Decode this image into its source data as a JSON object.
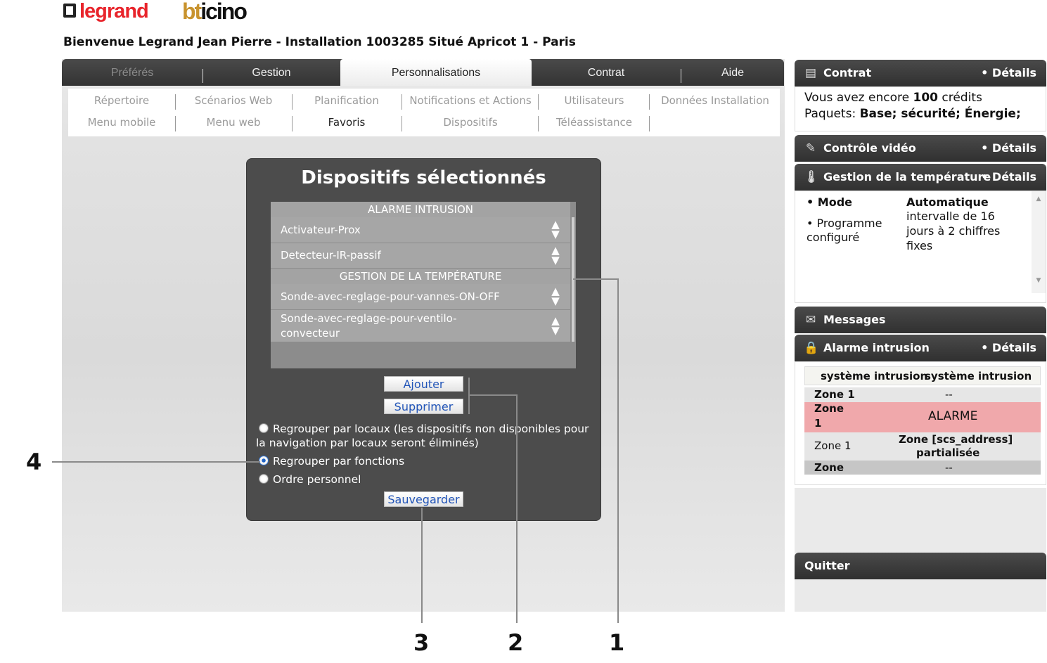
{
  "brand": {
    "legrand": "legrand",
    "bticino_b": "bt",
    "bticino_rest": "icino"
  },
  "welcome": "Bienvenue Legrand Jean Pierre - Installation 1003285 Situé Apricot 1 - Paris",
  "tabs": [
    "Préférés",
    "Gestion",
    "Personnalisations",
    "Contrat",
    "Aide"
  ],
  "submenu": {
    "row1": [
      "Répertoire",
      "Scénarios Web",
      "Planification",
      "Notifications et Actions",
      "Utilisateurs",
      "Données Installation"
    ],
    "row2": [
      "Menu mobile",
      "Menu web",
      "Favoris",
      "Dispositifs",
      "Téléassistance"
    ]
  },
  "devices": {
    "title": "Dispositifs sélectionnés",
    "categories": [
      "ALARME INTRUSION",
      "GESTION DE LA TEMPÉRATURE"
    ],
    "items": [
      "Activateur-Prox",
      "Detecteur-IR-passif",
      "Sonde-avec-reglage-pour-vannes-ON-OFF",
      "Sonde-avec-reglage-pour-ventilo-",
      "convecteur"
    ],
    "add_label": "Ajouter",
    "remove_label": "Supprimer",
    "radio_locaux_1": "Regrouper par locaux (les dispositifs non disponibles pour",
    "radio_locaux_2": "la navigation par locaux seront éliminés)",
    "radio_fonctions": "Regrouper par fonctions",
    "radio_perso": "Ordre personnel",
    "save_label": "Sauvegarder"
  },
  "callouts": [
    "1",
    "2",
    "3",
    "4"
  ],
  "sidebar": {
    "contrat": {
      "title": "Contrat",
      "details": "• Détails",
      "line1_pre": "Vous avez encore ",
      "credits": "100",
      "line1_post": " crédits",
      "line2_pre": "Paquets: ",
      "packages": "Base; sécurité; Énergie;"
    },
    "video": {
      "title": "Contrôle vidéo",
      "details": "• Détails"
    },
    "temperature": {
      "title": "Gestion de la température",
      "details": "• Détails",
      "mode_label": "• Mode",
      "mode_value": "Automatique",
      "prog_label_1": "• Programme",
      "prog_label_2": "configuré",
      "prog_value_1": "intervalle de 16",
      "prog_value_2": "jours à 2 chiffres",
      "prog_value_3": "fixes"
    },
    "messages": {
      "title": "Messages"
    },
    "alarm": {
      "title": "Alarme intrusion",
      "details": "• Détails",
      "header_1": "système intrusion",
      "header_2": "système intrusion",
      "rows": [
        {
          "zone": "Zone 1",
          "status": "--"
        },
        {
          "zone_1": "Zone",
          "zone_2": "1",
          "status": "ALARME"
        },
        {
          "zone": "Zone 1",
          "status_1": "Zone [scs_address]",
          "status_2": "partialisée"
        },
        {
          "zone": "Zone",
          "status": "--"
        }
      ]
    },
    "quit": "Quitter"
  },
  "colors": {
    "alarm_row": "#f0a8ab",
    "accent_blue": "#2255b8",
    "logo_red": "#e8242b"
  }
}
